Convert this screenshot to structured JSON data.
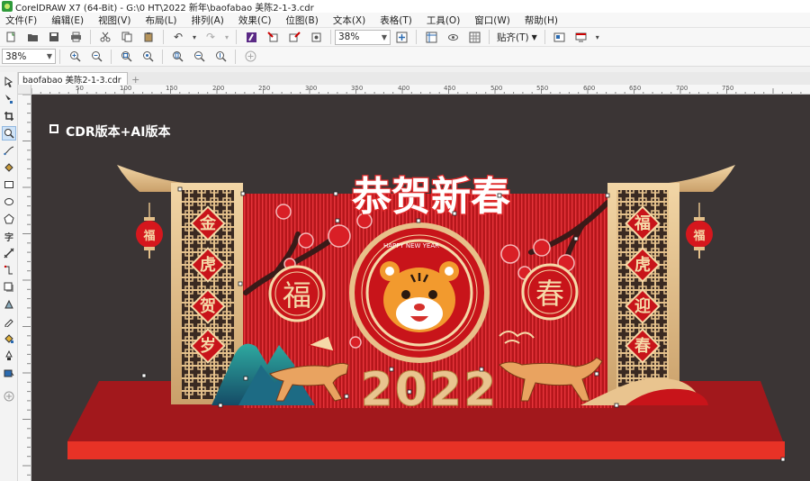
{
  "window": {
    "title": "CorelDRAW X7 (64-Bit) - G:\\0 HT\\2022 新年\\baofabao 美陈2-1-3.cdr"
  },
  "menu": [
    "文件(F)",
    "编辑(E)",
    "视图(V)",
    "布局(L)",
    "排列(A)",
    "效果(C)",
    "位图(B)",
    "文本(X)",
    "表格(T)",
    "工具(O)",
    "窗口(W)",
    "帮助(H)"
  ],
  "toolbar": {
    "zoom_value": "38%",
    "snap_label": "贴齐(T)"
  },
  "propertybar": {
    "zoom_value": "38%"
  },
  "doc_tab": {
    "label": "baofabao 美陈2-1-3.cdr"
  },
  "ruler": {
    "top_ticks": [
      "50",
      "100",
      "150",
      "200",
      "250",
      "300",
      "350",
      "400",
      "450",
      "500",
      "550",
      "600",
      "650",
      "700",
      "750"
    ]
  },
  "canvas": {
    "background": "#3b3535",
    "label": "CDR版本+AI版本",
    "title_art": "恭贺新春",
    "banner_small": "HAPPY NEW YEAR",
    "year": "2022",
    "left_char": "福",
    "right_char": "春",
    "left_couplet": [
      "金",
      "虎",
      "贺",
      "岁"
    ],
    "right_couplet": [
      "福",
      "虎",
      "迎",
      "春"
    ],
    "lantern_char": "福",
    "colors": {
      "red": "#d4171c",
      "gold": "#e5bf83",
      "platform": "#b21b1e",
      "base": "#e83226"
    }
  }
}
